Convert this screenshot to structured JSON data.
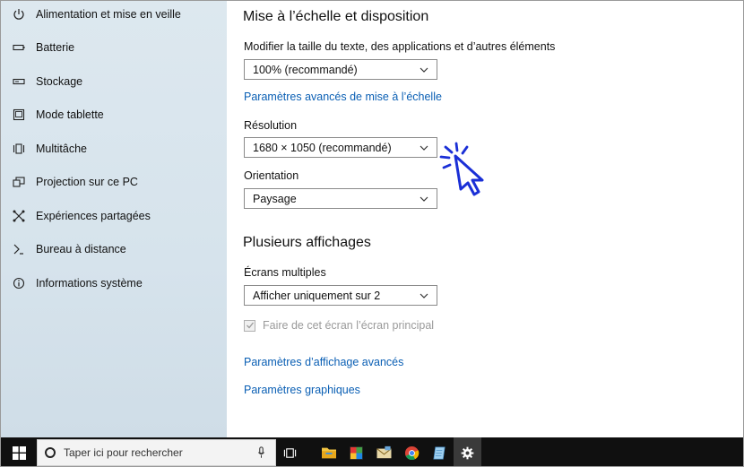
{
  "sidebar": {
    "items": [
      {
        "label": "Alimentation et mise en veille",
        "icon": "power-icon"
      },
      {
        "label": "Batterie",
        "icon": "battery-icon"
      },
      {
        "label": "Stockage",
        "icon": "storage-icon"
      },
      {
        "label": "Mode tablette",
        "icon": "tablet-icon"
      },
      {
        "label": "Multitâche",
        "icon": "multitask-icon"
      },
      {
        "label": "Projection sur ce PC",
        "icon": "projection-icon"
      },
      {
        "label": "Expériences partagées",
        "icon": "shared-experiences-icon"
      },
      {
        "label": "Bureau à distance",
        "icon": "remote-desktop-icon"
      },
      {
        "label": "Informations système",
        "icon": "info-icon"
      }
    ]
  },
  "main": {
    "scale_section": {
      "title": "Mise à l’échelle et disposition",
      "scale_label": "Modifier la taille du texte, des applications et d’autres éléments",
      "scale_value": "100% (recommandé)",
      "advanced_scaling_link": "Paramètres avancés de mise à l’échelle",
      "resolution_label": "Résolution",
      "resolution_value": "1680 × 1050 (recommandé)",
      "orientation_label": "Orientation",
      "orientation_value": "Paysage"
    },
    "multi_section": {
      "title": "Plusieurs affichages",
      "multi_label": "Écrans multiples",
      "multi_value": "Afficher uniquement sur 2",
      "main_display_checkbox": "Faire de cet écran l’écran principal",
      "main_display_checked": true,
      "main_display_enabled": false,
      "advanced_display_link": "Paramètres d’affichage avancés",
      "graphics_link": "Paramètres graphiques"
    }
  },
  "taskbar": {
    "search_placeholder": "Taper ici pour rechercher",
    "apps": [
      "task-view-icon",
      "file-explorer-icon",
      "photos-icon",
      "mail-icon",
      "chrome-icon",
      "notepad-icon",
      "settings-icon"
    ]
  },
  "colors": {
    "link": "#0a5fb4",
    "cursor_accent": "#1a2fd6",
    "taskbar": "#101010"
  }
}
